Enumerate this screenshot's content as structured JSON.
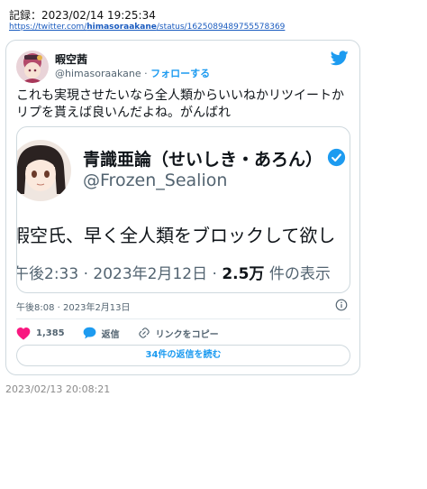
{
  "record": {
    "label": "記録：2023/02/14 19:25:34"
  },
  "source": {
    "url_prefix": "https://twitter.com/",
    "url_user": "himasoraakane",
    "url_suffix": "/status/1625089489755578369"
  },
  "tweet": {
    "name": "暇空茜",
    "handle": "@himasoraakane",
    "separator": "·",
    "follow_label": "フォローする",
    "text": "これも実現させたいなら全人類からいいねかリツイートかリプを貰えば良いんだよね。がんばれ",
    "timestamp": "午後8:08 · 2023年2月13日",
    "likes": "1,385",
    "reply_label": "返信",
    "copy_link_label": "リンクをコピー",
    "read_replies_label": "34件の返信を読む"
  },
  "quoted": {
    "name": "青識亜論（せいしき・あろん）",
    "handle": "@Frozen_Sealion",
    "text": "暇空氏、早く全人類をブロックして欲し",
    "meta_time": "午後2:33 · 2023年2月12日 ·",
    "meta_views": "2.5万",
    "meta_views_suffix": "件の表示"
  },
  "footer": {
    "date": "2023/02/13 20:08:21"
  },
  "colors": {
    "accent": "#1d9bf0",
    "like": "#f91880",
    "muted": "#536471",
    "border": "#cfd9de"
  },
  "icons": {
    "logo": "twitter-bird-icon",
    "verified": "verified-badge-icon",
    "info": "info-icon",
    "like": "heart-icon",
    "reply": "speech-bubble-icon",
    "link": "link-icon"
  }
}
